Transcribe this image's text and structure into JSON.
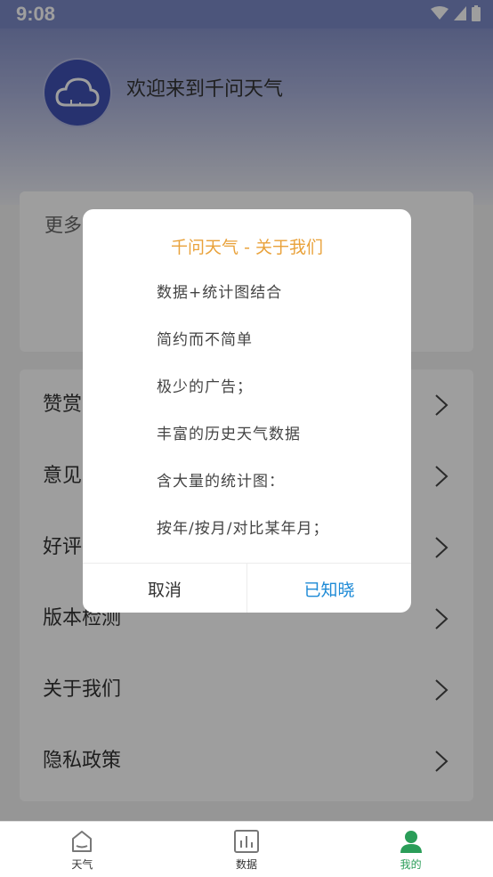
{
  "status": {
    "time": "9:08"
  },
  "profile": {
    "welcome": "欢迎来到千问天气"
  },
  "more": {
    "title": "更多"
  },
  "list": [
    {
      "label": "赞赏"
    },
    {
      "label": "意见"
    },
    {
      "label": "好评"
    },
    {
      "label": "版本检测"
    },
    {
      "label": "关于我们"
    },
    {
      "label": "隐私政策"
    }
  ],
  "dialog": {
    "title": "千问天气 - 关于我们",
    "lines": [
      "数据+统计图结合",
      "简约而不简单",
      "极少的广告；",
      "丰富的历史天气数据",
      "含大量的统计图：",
      "按年/按月/对比某年月；"
    ],
    "cancel": "取消",
    "ok": "已知晓"
  },
  "nav": [
    {
      "label": "天气",
      "icon": "house-icon"
    },
    {
      "label": "数据",
      "icon": "bar-chart-icon"
    },
    {
      "label": "我的",
      "icon": "person-icon"
    }
  ],
  "colors": {
    "accent": "#2a9d58",
    "dialog_title": "#e9a23b",
    "confirm": "#1d8ad6"
  }
}
